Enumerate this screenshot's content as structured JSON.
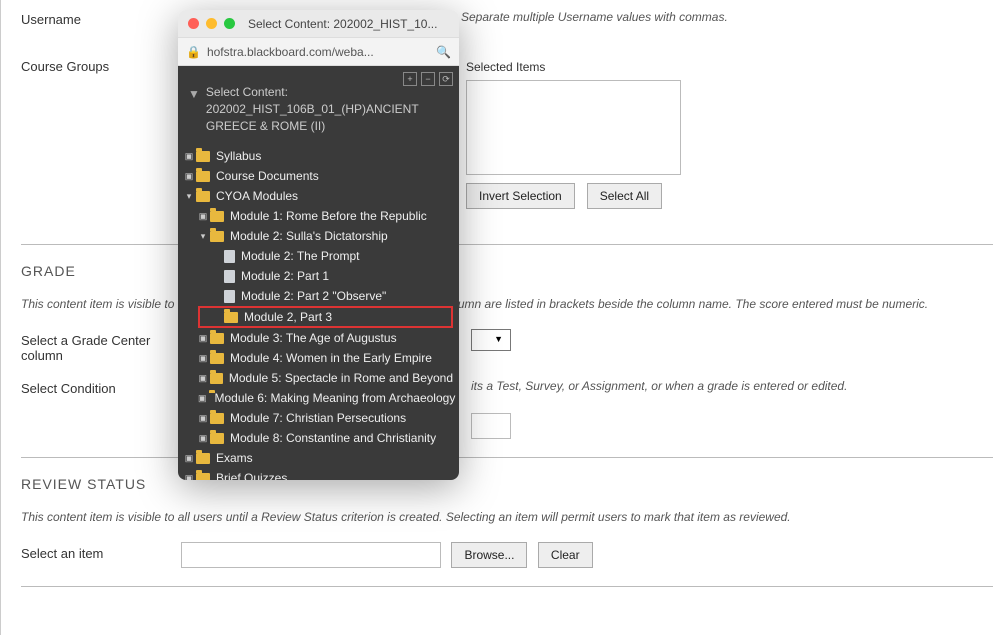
{
  "form": {
    "username_label": "Username",
    "username_hint": "Separate multiple Username values with commas.",
    "course_groups_label": "Course Groups",
    "selected_items_label": "Selected Items",
    "invert_btn": "Invert Selection",
    "selectall_btn": "Select All"
  },
  "grade": {
    "heading": "GRADE",
    "desc": "This content item is visible to all users until a Grade Center grade or calculated column are listed in brackets beside the column name. The score entered must be numeric.",
    "select_col_label": "Select a Grade Center column",
    "select_cond_label": "Select Condition",
    "cond_hint": "its a Test, Survey, or Assignment, or when a grade is entered or edited."
  },
  "review": {
    "heading": "REVIEW STATUS",
    "desc": "This content item is visible to all users until a Review Status criterion is created. Selecting an item will permit users to mark that item as reviewed.",
    "select_item_label": "Select an item",
    "browse_btn": "Browse...",
    "clear_btn": "Clear"
  },
  "popup": {
    "title": "Select Content: 202002_HIST_10...",
    "url": "hofstra.blackboard.com/weba...",
    "root_label": "Select Content:",
    "root_course": "202002_HIST_106B_01_(HP)ANCIENT GREECE & ROME (II)",
    "tree": {
      "syllabus": "Syllabus",
      "course_docs": "Course Documents",
      "cyoa": "CYOA Modules",
      "m1": "Module 1: Rome Before the Republic",
      "m2": "Module 2: Sulla's Dictatorship",
      "m2_prompt": "Module 2: The Prompt",
      "m2_p1": "Module 2: Part 1",
      "m2_p2": "Module 2: Part 2 \"Observe\"",
      "m2_p3": "Module 2, Part 3",
      "m3": "Module 3: The Age of Augustus",
      "m4": "Module 4: Women in the Early Empire",
      "m5": "Module 5: Spectacle in Rome and Beyond",
      "m6": "Module 6: Making Meaning from Archaeology",
      "m7": "Module 7: Christian Persecutions",
      "m8": "Module 8: Constantine and Christianity",
      "exams": "Exams",
      "quizzes": "Brief Quizzes"
    }
  }
}
